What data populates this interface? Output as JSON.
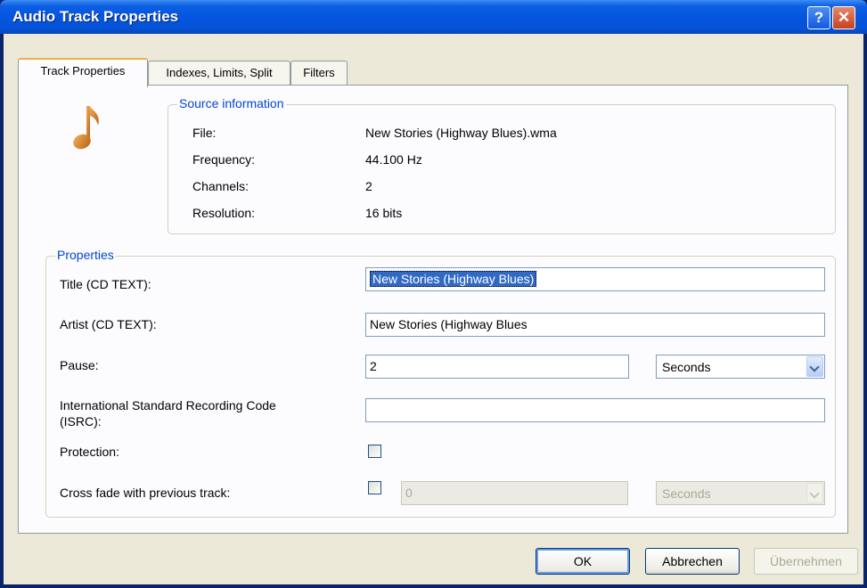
{
  "window": {
    "title": "Audio Track Properties"
  },
  "tabs": [
    {
      "label": "Track Properties"
    },
    {
      "label": "Indexes, Limits, Split"
    },
    {
      "label": "Filters"
    }
  ],
  "source_info": {
    "legend": "Source information",
    "rows": [
      {
        "label": "File:",
        "value": "New Stories (Highway Blues).wma"
      },
      {
        "label": "Frequency:",
        "value": "44.100 Hz"
      },
      {
        "label": "Channels:",
        "value": "2"
      },
      {
        "label": "Resolution:",
        "value": "16 bits"
      }
    ]
  },
  "properties": {
    "legend": "Properties",
    "title_label": "Title (CD TEXT):",
    "title_value": "New Stories (Highway Blues)",
    "artist_label": "Artist (CD TEXT):",
    "artist_value": "New Stories (Highway Blues",
    "pause_label": "Pause:",
    "pause_value": "2",
    "pause_unit": "Seconds",
    "isrc_label_line1": "International Standard Recording Code",
    "isrc_label_line2": "(ISRC):",
    "isrc_value": "",
    "protection_label": "Protection:",
    "protection_checked": false,
    "crossfade_label": "Cross fade with previous track:",
    "crossfade_checked": false,
    "crossfade_value": "0",
    "crossfade_unit": "Seconds"
  },
  "buttons": {
    "ok": "OK",
    "cancel": "Abbrechen",
    "apply": "Übernehmen"
  },
  "icons": {
    "help": "help-icon",
    "close": "close-icon",
    "note": "music-note-icon"
  }
}
